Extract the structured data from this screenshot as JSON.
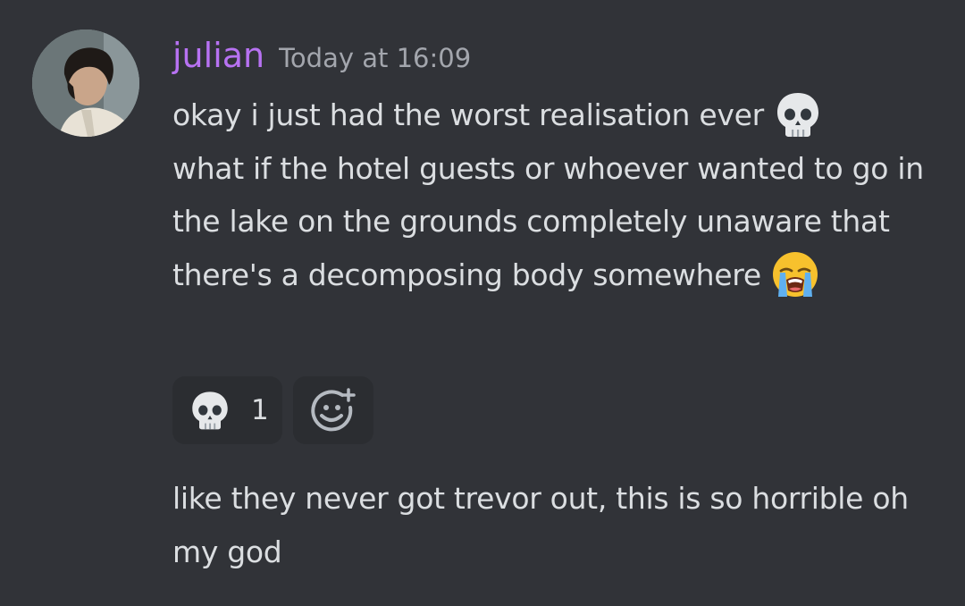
{
  "message": {
    "username": "julian",
    "timestamp": "Today at 16:09",
    "text": "okay i just had the worst realisation ever",
    "text_cont": "what if the hotel guests or whoever wanted to go in the lake on the grounds completely unaware that there's a decomposing body somewhere",
    "inline_emojis": [
      "skull-emoji",
      "loudly-crying-face-emoji"
    ]
  },
  "reactions": [
    {
      "emoji": "skull-emoji",
      "count": "1"
    }
  ],
  "add_reaction_icon": "add-reaction-icon",
  "followup": {
    "text": "like they never got trevor out, this is so horrible oh my god"
  },
  "colors": {
    "background": "#313338",
    "username": "#b772f2",
    "timestamp": "#a3a6ad",
    "text": "#dbdee1",
    "reaction_bg": "#2b2d31"
  }
}
